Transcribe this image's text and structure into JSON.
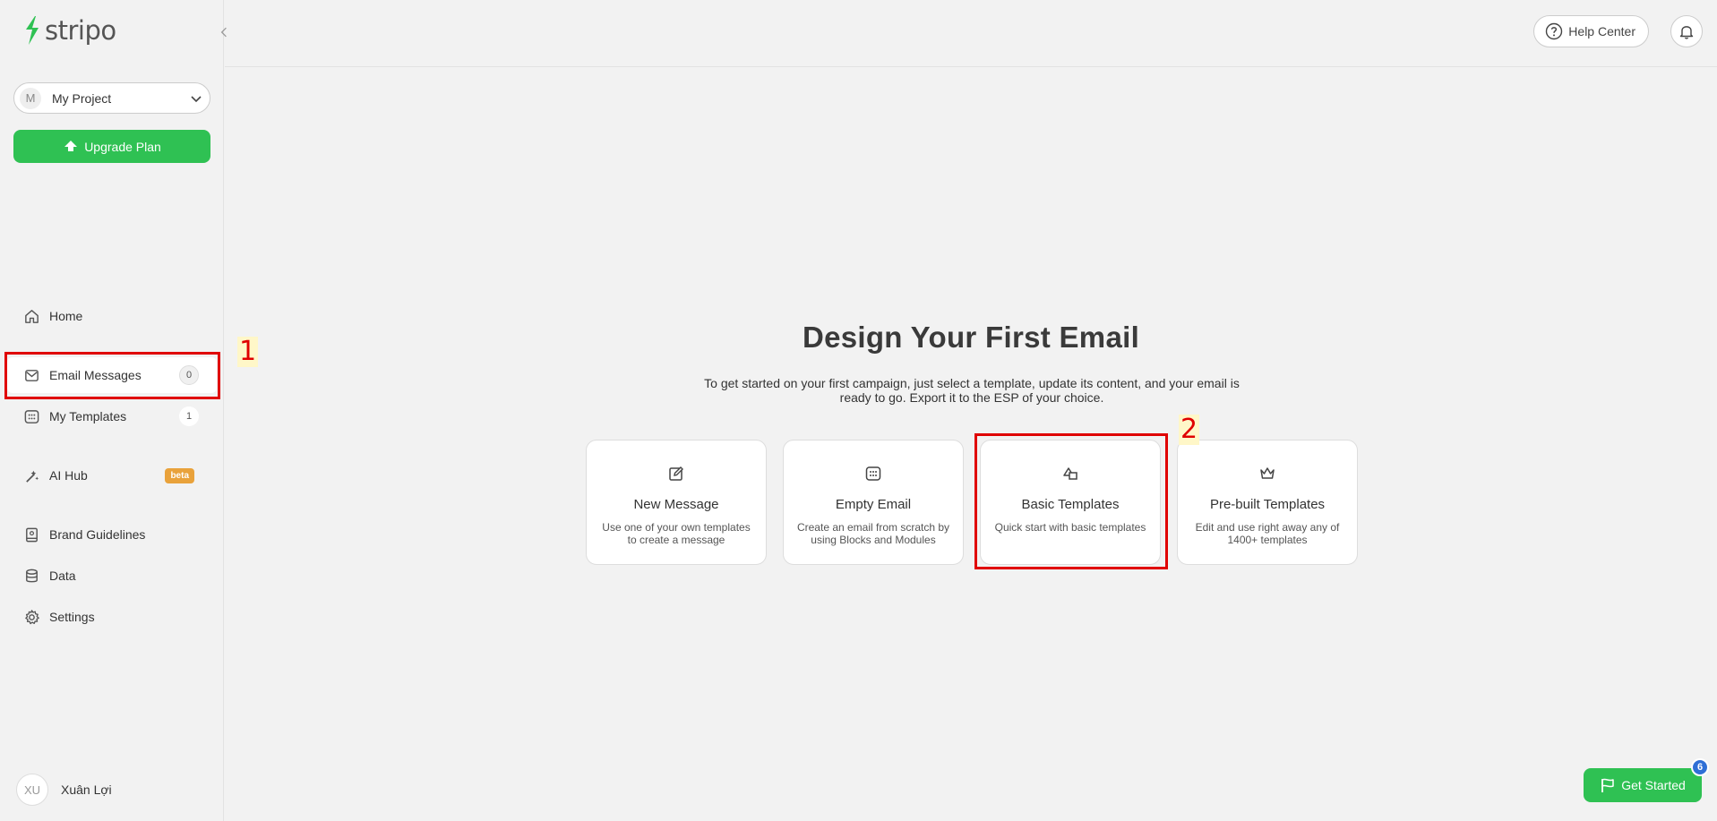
{
  "app": {
    "logo_text": "stripo"
  },
  "project": {
    "avatar_letter": "M",
    "name": "My Project"
  },
  "upgrade": {
    "label": "Upgrade Plan"
  },
  "nav": {
    "home": "Home",
    "email_messages": {
      "label": "Email Messages",
      "count": "0"
    },
    "my_templates": {
      "label": "My Templates",
      "count": "1"
    },
    "ai_hub": {
      "label": "AI Hub",
      "badge": "beta"
    },
    "brand_guidelines": "Brand Guidelines",
    "data": "Data",
    "settings": "Settings"
  },
  "user": {
    "initials": "XU",
    "name": "Xuân Lợi"
  },
  "header": {
    "help_label": "Help Center"
  },
  "main": {
    "title": "Design Your First Email",
    "subtitle": "To get started on your first campaign, just select a template, update its content, and your email is ready to go. Export it to the ESP of your choice.",
    "cards": [
      {
        "title": "New Message",
        "desc": "Use one of your own templates to create a message",
        "icon": "edit-icon"
      },
      {
        "title": "Empty Email",
        "desc": "Create an email from scratch by using Blocks and Modules",
        "icon": "grid-icon"
      },
      {
        "title": "Basic Templates",
        "desc": "Quick start with basic templates",
        "icon": "shapes-icon"
      },
      {
        "title": "Pre-built Templates",
        "desc": "Edit and use right away any of 1400+ templates",
        "icon": "crown-icon"
      }
    ]
  },
  "annotations": {
    "first": "1",
    "second": "2"
  },
  "get_started": {
    "label": "Get Started",
    "badge": "6"
  },
  "colors": {
    "brand_green": "#2fc153",
    "annotation_red": "#e00000",
    "beta_orange": "#e9a23b",
    "badge_blue": "#2f6fd6"
  }
}
